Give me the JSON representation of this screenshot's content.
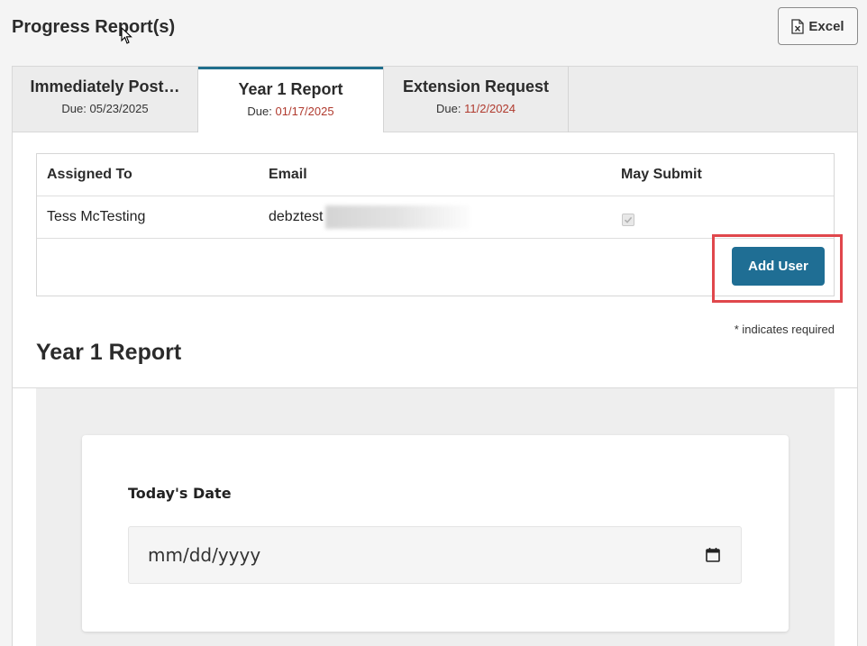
{
  "header": {
    "title": "Progress Report(s)",
    "excel_label": "Excel"
  },
  "tabs": [
    {
      "label": "Immediately Post…",
      "due_prefix": "Due:",
      "due_date": "05/23/2025",
      "active": false
    },
    {
      "label": "Year 1 Report",
      "due_prefix": "Due:",
      "due_date": "01/17/2025",
      "active": true
    },
    {
      "label": "Extension Request",
      "due_prefix": "Due:",
      "due_date": "11/2/2024",
      "active": false
    }
  ],
  "users_table": {
    "columns": [
      "Assigned To",
      "Email",
      "May Submit"
    ],
    "rows": [
      {
        "assigned_to": "Tess McTesting",
        "email": "debztest",
        "may_submit": true
      }
    ],
    "add_user_label": "Add User"
  },
  "required_note": "* indicates required",
  "section_title": "Year 1 Report",
  "form": {
    "date_label": "Today's Date",
    "date_placeholder": "mm/dd/yyyy"
  },
  "colors": {
    "accent": "#1f6e94",
    "due_overdue": "#b03a2e",
    "highlight": "#e0474c"
  }
}
